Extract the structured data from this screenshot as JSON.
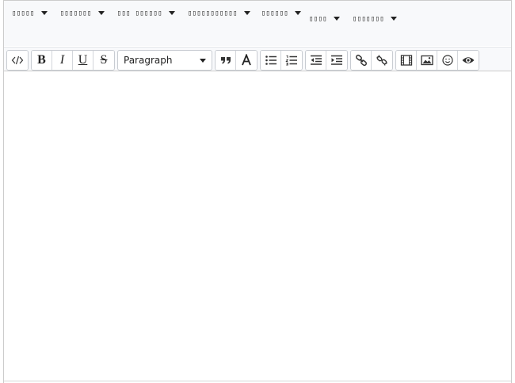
{
  "menubar": {
    "items": [
      {
        "label": "▯▯▯▯▯"
      },
      {
        "label": "▯▯▯▯▯▯▯"
      },
      {
        "label": "▯▯▯ ▯▯▯▯▯▯"
      },
      {
        "label": "▯▯▯▯▯▯▯▯▯▯▯"
      },
      {
        "label": "▯▯▯▯▯▯"
      },
      {
        "label": "▯▯▯▯"
      },
      {
        "label": "▯▯▯▯▯▯▯"
      }
    ]
  },
  "toolbar": {
    "format_select": {
      "value": "Paragraph"
    }
  },
  "editor": {
    "content": ""
  }
}
